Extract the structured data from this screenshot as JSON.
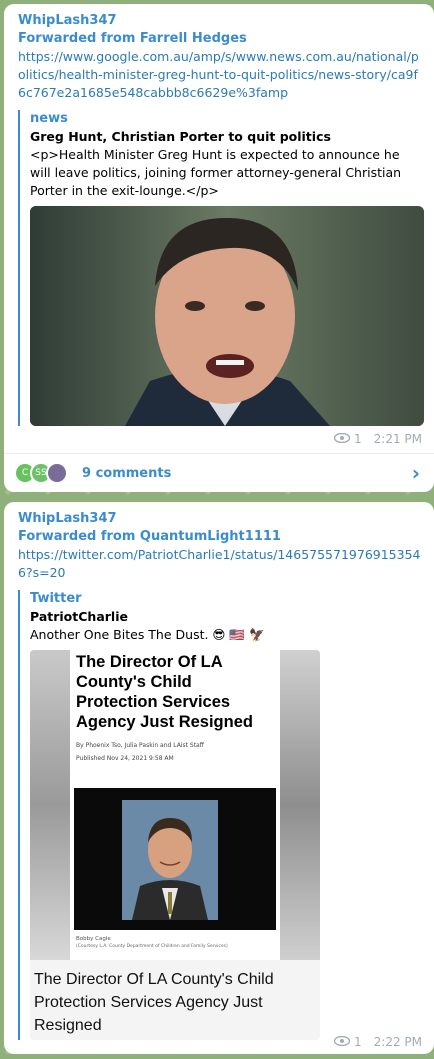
{
  "post1": {
    "author": "WhipLash347",
    "forwarded": "Forwarded from Farrell Hedges",
    "link": "https://www.google.com.au/amp/s/www.news.com.au/national/politics/health-minister-greg-hunt-to-quit-politics/news-story/ca9f6c767e2a1685e548cabbb8c6629e%3famp",
    "preview": {
      "site": "news",
      "title": "Greg Hunt, Christian Porter to quit politics",
      "description": "<p>Health Minister Greg Hunt is expected to announce he will leave politics, joining former attorney-general Christian Porter in the exit-lounge.</p>"
    },
    "views": "1",
    "time": "2:21 PM",
    "comments": {
      "label": "9 comments",
      "avatars": [
        "C",
        "SS",
        ""
      ]
    }
  },
  "post2": {
    "author": "WhipLash347",
    "forwarded": "Forwarded from QuantumLight1111",
    "link": "https://twitter.com/PatriotCharlie1/status/1465755719769153546?s=20",
    "preview": {
      "site": "Twitter",
      "title": "PatriotCharlie",
      "description": "Another One Bites The Dust. 😎 🇺🇸 🦅",
      "image": {
        "headline": "The Director Of LA County's Child Protection Services Agency Just Resigned",
        "byline": "By Phoenix Tso, Julia Paskin and LAist Staff",
        "published": "Published Nov 24, 2021 9:58 AM",
        "caption_name": "Bobby Cagle",
        "caption_credit": "(Courtesy L.A. County Department of Children and Family Services)",
        "bottom_text": "The Director Of LA County's Child Protection Services Agency Just Resigned"
      }
    },
    "views": "1",
    "time": "2:22 PM"
  }
}
